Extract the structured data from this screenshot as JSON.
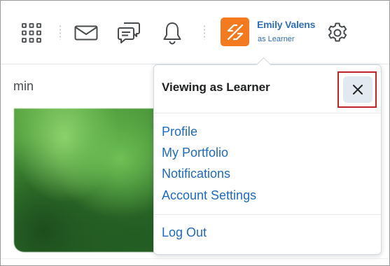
{
  "header": {
    "user_name": "Emily Valens",
    "user_role": "as Learner"
  },
  "icons": {
    "apps": "grid-icon",
    "mail": "envelope-icon",
    "chat": "chat-bubbles-icon",
    "notifications": "bell-icon",
    "avatar": "role-switch-icon",
    "settings": "gear-icon",
    "close": "close-x-icon"
  },
  "colors": {
    "avatar_bg": "#f47a20",
    "link": "#1e6bbf",
    "highlight": "#c0242b",
    "close_bg": "#e3e9f1"
  },
  "background": {
    "text_fragment": "min"
  },
  "popover": {
    "title": "Viewing as Learner",
    "menu": [
      "Profile",
      "My Portfolio",
      "Notifications",
      "Account Settings"
    ],
    "logout": "Log Out"
  }
}
